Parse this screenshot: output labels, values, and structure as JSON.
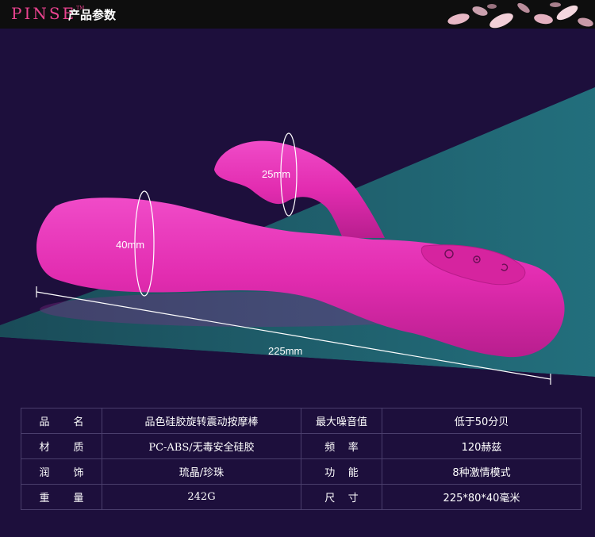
{
  "header": {
    "brand": "PINSE",
    "brand_tm": "TM",
    "title": "产品参数"
  },
  "dimensions": {
    "diameter_main": "40mm",
    "diameter_tip": "25mm",
    "length": "225mm"
  },
  "colors": {
    "background": "#1d0f3c",
    "product": "#e22cb0",
    "product_highlight": "#f04bc8",
    "teal_light": "#1c5e68",
    "brand": "#e9438f"
  },
  "specs": [
    {
      "label1": [
        "品",
        "名"
      ],
      "value1": "品色硅胶旋转震动按摩棒",
      "label2": "最大噪音值",
      "value2": "低于50分贝"
    },
    {
      "label1": [
        "材",
        "质"
      ],
      "value1": "PC-ABS/无毒安全硅胶",
      "label2": "频    率",
      "value2": "120赫兹"
    },
    {
      "label1": [
        "润",
        "饰"
      ],
      "value1": "琉晶/珍珠",
      "label2": "功    能",
      "value2": "8种激情模式"
    },
    {
      "label1": [
        "重",
        "量"
      ],
      "value1": "242G",
      "label2": "尺    寸",
      "value2": "225*80*40毫米"
    }
  ]
}
